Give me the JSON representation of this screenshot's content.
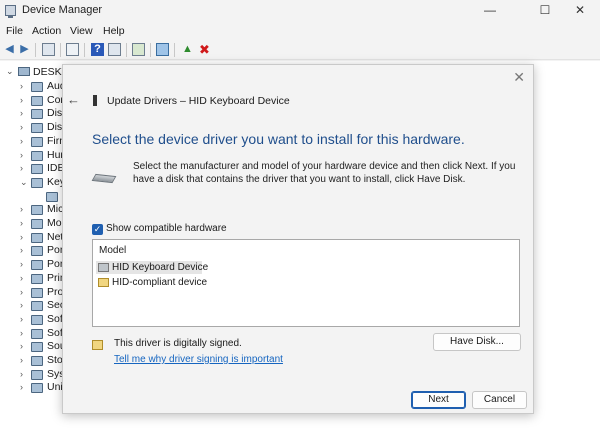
{
  "window": {
    "title": "Device Manager",
    "controls": {
      "minimize": "—",
      "maximize": "☐",
      "close": "✕"
    }
  },
  "menu": [
    "File",
    "Action",
    "View",
    "Help"
  ],
  "tree": {
    "root": "DESKTO",
    "items": [
      {
        "label": "Aud",
        "expanded": false
      },
      {
        "label": "Cor",
        "expanded": false
      },
      {
        "label": "Disk",
        "expanded": false
      },
      {
        "label": "Disp",
        "expanded": false
      },
      {
        "label": "Firn",
        "expanded": false
      },
      {
        "label": "Hur",
        "expanded": false
      },
      {
        "label": "IDE",
        "expanded": false
      },
      {
        "label": "Key",
        "expanded": true
      },
      {
        "label": "",
        "expanded": false
      },
      {
        "label": "Mic",
        "expanded": false
      },
      {
        "label": "Mo",
        "expanded": false
      },
      {
        "label": "Net",
        "expanded": false
      },
      {
        "label": "Por",
        "expanded": false
      },
      {
        "label": "Por",
        "expanded": false
      },
      {
        "label": "Prin",
        "expanded": false
      },
      {
        "label": "Pro",
        "expanded": false
      },
      {
        "label": "Sec",
        "expanded": false
      },
      {
        "label": "Soft",
        "expanded": false
      },
      {
        "label": "Soft",
        "expanded": false
      },
      {
        "label": "Sou",
        "expanded": false
      },
      {
        "label": "Stor",
        "expanded": false
      },
      {
        "label": "Syst",
        "expanded": false
      },
      {
        "label": "Univ",
        "expanded": false
      }
    ]
  },
  "dialog": {
    "title": "Update Drivers – HID Keyboard Device",
    "close_glyph": "✕",
    "back_glyph": "←",
    "heading": "Select the device driver you want to install for this hardware.",
    "description": "Select the manufacturer and model of your hardware device and then click Next. If you have a disk that contains the driver that you want to install, click Have Disk.",
    "show_compatible": {
      "label": "Show compatible hardware",
      "checked": true,
      "glyph": "✓"
    },
    "model_list": {
      "header": "Model",
      "items": [
        {
          "label": "HID Keyboard Device",
          "selected": true
        },
        {
          "label": "HID-compliant device",
          "selected": false
        }
      ]
    },
    "signed_text": "This driver is digitally signed.",
    "signing_link": "Tell me why driver signing is important",
    "buttons": {
      "have_disk": "Have Disk...",
      "next": "Next",
      "cancel": "Cancel"
    }
  },
  "colors": {
    "accent": "#1f5fb0",
    "heading": "#1f4e8c",
    "link": "#1565c0",
    "delete_red": "#d0191a",
    "enable_green": "#2e8b2e"
  }
}
